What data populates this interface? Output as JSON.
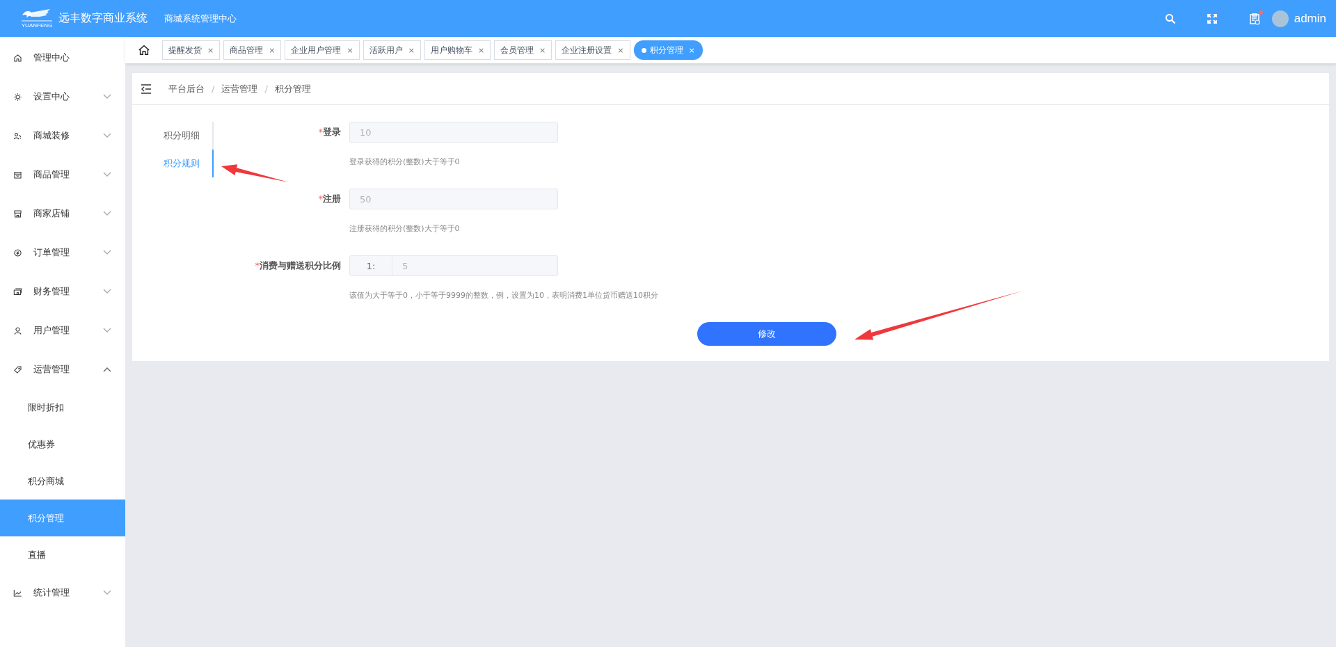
{
  "header": {
    "logo_caption": "YUANFENG",
    "brand": "远丰数字商业系统",
    "subtitle": "商城系统管理中心",
    "unread": true,
    "user": "admin"
  },
  "sidebar": {
    "items": [
      {
        "label": "管理中心",
        "kind": "link"
      },
      {
        "label": "设置中心",
        "kind": "group",
        "expanded": false
      },
      {
        "label": "商城装修",
        "kind": "group",
        "expanded": false
      },
      {
        "label": "商品管理",
        "kind": "group",
        "expanded": false
      },
      {
        "label": "商家店铺",
        "kind": "group",
        "expanded": false
      },
      {
        "label": "订单管理",
        "kind": "group",
        "expanded": false
      },
      {
        "label": "财务管理",
        "kind": "group",
        "expanded": false
      },
      {
        "label": "用户管理",
        "kind": "group",
        "expanded": false
      },
      {
        "label": "运营管理",
        "kind": "group",
        "expanded": true,
        "children": [
          {
            "label": "限时折扣",
            "selected": false
          },
          {
            "label": "优惠券",
            "selected": false
          },
          {
            "label": "积分商城",
            "selected": false
          },
          {
            "label": "积分管理",
            "selected": true
          },
          {
            "label": "直播",
            "selected": false
          }
        ]
      },
      {
        "label": "统计管理",
        "kind": "group",
        "expanded": false
      }
    ]
  },
  "tabs": [
    {
      "label": "提醒发货",
      "close": "×",
      "selected": false
    },
    {
      "label": "商品管理",
      "close": "×",
      "selected": false
    },
    {
      "label": "企业用户管理",
      "close": "×",
      "selected": false
    },
    {
      "label": "活跃用户",
      "close": "×",
      "selected": false
    },
    {
      "label": "用户购物车",
      "close": "×",
      "selected": false
    },
    {
      "label": "会员管理",
      "close": "×",
      "selected": false
    },
    {
      "label": "企业注册设置",
      "close": "×",
      "selected": false
    },
    {
      "label": "积分管理",
      "close": "×",
      "selected": true
    }
  ],
  "breadcrumb": {
    "separator": "/",
    "items": [
      "平台后台",
      "运营管理",
      "积分管理"
    ]
  },
  "side_tabs": [
    {
      "label": "积分明细",
      "selected": false
    },
    {
      "label": "积分规则",
      "selected": true
    }
  ],
  "form": {
    "required_mark": "*",
    "fields": [
      {
        "kind": "text",
        "label": "登录",
        "required": true,
        "value": "10",
        "disabled": true,
        "hint": "登录获得的积分(整数)大于等于0"
      },
      {
        "kind": "text",
        "label": "注册",
        "required": true,
        "value": "50",
        "disabled": true,
        "hint": "注册获得的积分(整数)大于等于0"
      },
      {
        "kind": "ratio",
        "label": "消费与赠送积分比例",
        "required": true,
        "prefix": "1:",
        "value": "5",
        "disabled": true,
        "hint": "该值为大于等于0，小于等于9999的整数，例，设置为10，表明消费1单位货币赠送10积分"
      }
    ],
    "submit": "修改"
  }
}
